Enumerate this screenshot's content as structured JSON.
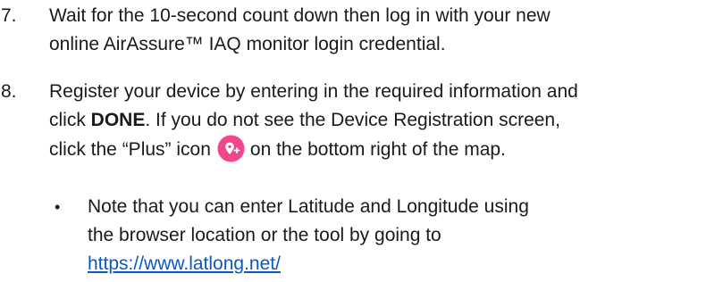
{
  "steps": [
    {
      "number": "7.",
      "lines": [
        "Wait for the 10-second count down then log in with your new",
        "online AirAssure™ IAQ monitor login credential."
      ]
    },
    {
      "number": "8.",
      "line1": "Register your device by entering in the required information and",
      "line2_pre": "click ",
      "line2_bold": "DONE",
      "line2_post": ". If you do not see the Device Registration screen,",
      "line3_pre": "click the “Plus” icon",
      "line3_post": "on the bottom right of the map.",
      "icon": "map-pin-plus-icon",
      "icon_color": "#f0468a"
    }
  ],
  "note": {
    "bullet": "•",
    "lines": [
      "Note that you can enter Latitude and Longitude using",
      "the browser location or the tool by going to"
    ],
    "link": "https://www.latlong.net/",
    "link_color": "#0b57c8"
  }
}
